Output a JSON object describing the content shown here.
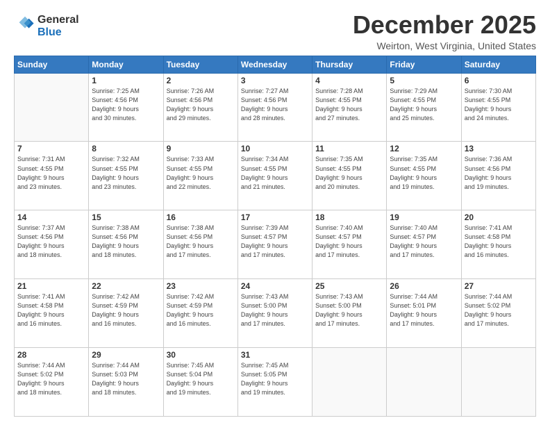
{
  "header": {
    "logo_line1": "General",
    "logo_line2": "Blue",
    "month": "December 2025",
    "location": "Weirton, West Virginia, United States"
  },
  "weekdays": [
    "Sunday",
    "Monday",
    "Tuesday",
    "Wednesday",
    "Thursday",
    "Friday",
    "Saturday"
  ],
  "weeks": [
    [
      {
        "day": "",
        "info": ""
      },
      {
        "day": "1",
        "info": "Sunrise: 7:25 AM\nSunset: 4:56 PM\nDaylight: 9 hours\nand 30 minutes."
      },
      {
        "day": "2",
        "info": "Sunrise: 7:26 AM\nSunset: 4:56 PM\nDaylight: 9 hours\nand 29 minutes."
      },
      {
        "day": "3",
        "info": "Sunrise: 7:27 AM\nSunset: 4:56 PM\nDaylight: 9 hours\nand 28 minutes."
      },
      {
        "day": "4",
        "info": "Sunrise: 7:28 AM\nSunset: 4:55 PM\nDaylight: 9 hours\nand 27 minutes."
      },
      {
        "day": "5",
        "info": "Sunrise: 7:29 AM\nSunset: 4:55 PM\nDaylight: 9 hours\nand 25 minutes."
      },
      {
        "day": "6",
        "info": "Sunrise: 7:30 AM\nSunset: 4:55 PM\nDaylight: 9 hours\nand 24 minutes."
      }
    ],
    [
      {
        "day": "7",
        "info": "Sunrise: 7:31 AM\nSunset: 4:55 PM\nDaylight: 9 hours\nand 23 minutes."
      },
      {
        "day": "8",
        "info": "Sunrise: 7:32 AM\nSunset: 4:55 PM\nDaylight: 9 hours\nand 23 minutes."
      },
      {
        "day": "9",
        "info": "Sunrise: 7:33 AM\nSunset: 4:55 PM\nDaylight: 9 hours\nand 22 minutes."
      },
      {
        "day": "10",
        "info": "Sunrise: 7:34 AM\nSunset: 4:55 PM\nDaylight: 9 hours\nand 21 minutes."
      },
      {
        "day": "11",
        "info": "Sunrise: 7:35 AM\nSunset: 4:55 PM\nDaylight: 9 hours\nand 20 minutes."
      },
      {
        "day": "12",
        "info": "Sunrise: 7:35 AM\nSunset: 4:55 PM\nDaylight: 9 hours\nand 19 minutes."
      },
      {
        "day": "13",
        "info": "Sunrise: 7:36 AM\nSunset: 4:56 PM\nDaylight: 9 hours\nand 19 minutes."
      }
    ],
    [
      {
        "day": "14",
        "info": "Sunrise: 7:37 AM\nSunset: 4:56 PM\nDaylight: 9 hours\nand 18 minutes."
      },
      {
        "day": "15",
        "info": "Sunrise: 7:38 AM\nSunset: 4:56 PM\nDaylight: 9 hours\nand 18 minutes."
      },
      {
        "day": "16",
        "info": "Sunrise: 7:38 AM\nSunset: 4:56 PM\nDaylight: 9 hours\nand 17 minutes."
      },
      {
        "day": "17",
        "info": "Sunrise: 7:39 AM\nSunset: 4:57 PM\nDaylight: 9 hours\nand 17 minutes."
      },
      {
        "day": "18",
        "info": "Sunrise: 7:40 AM\nSunset: 4:57 PM\nDaylight: 9 hours\nand 17 minutes."
      },
      {
        "day": "19",
        "info": "Sunrise: 7:40 AM\nSunset: 4:57 PM\nDaylight: 9 hours\nand 17 minutes."
      },
      {
        "day": "20",
        "info": "Sunrise: 7:41 AM\nSunset: 4:58 PM\nDaylight: 9 hours\nand 16 minutes."
      }
    ],
    [
      {
        "day": "21",
        "info": "Sunrise: 7:41 AM\nSunset: 4:58 PM\nDaylight: 9 hours\nand 16 minutes."
      },
      {
        "day": "22",
        "info": "Sunrise: 7:42 AM\nSunset: 4:59 PM\nDaylight: 9 hours\nand 16 minutes."
      },
      {
        "day": "23",
        "info": "Sunrise: 7:42 AM\nSunset: 4:59 PM\nDaylight: 9 hours\nand 16 minutes."
      },
      {
        "day": "24",
        "info": "Sunrise: 7:43 AM\nSunset: 5:00 PM\nDaylight: 9 hours\nand 17 minutes."
      },
      {
        "day": "25",
        "info": "Sunrise: 7:43 AM\nSunset: 5:00 PM\nDaylight: 9 hours\nand 17 minutes."
      },
      {
        "day": "26",
        "info": "Sunrise: 7:44 AM\nSunset: 5:01 PM\nDaylight: 9 hours\nand 17 minutes."
      },
      {
        "day": "27",
        "info": "Sunrise: 7:44 AM\nSunset: 5:02 PM\nDaylight: 9 hours\nand 17 minutes."
      }
    ],
    [
      {
        "day": "28",
        "info": "Sunrise: 7:44 AM\nSunset: 5:02 PM\nDaylight: 9 hours\nand 18 minutes."
      },
      {
        "day": "29",
        "info": "Sunrise: 7:44 AM\nSunset: 5:03 PM\nDaylight: 9 hours\nand 18 minutes."
      },
      {
        "day": "30",
        "info": "Sunrise: 7:45 AM\nSunset: 5:04 PM\nDaylight: 9 hours\nand 19 minutes."
      },
      {
        "day": "31",
        "info": "Sunrise: 7:45 AM\nSunset: 5:05 PM\nDaylight: 9 hours\nand 19 minutes."
      },
      {
        "day": "",
        "info": ""
      },
      {
        "day": "",
        "info": ""
      },
      {
        "day": "",
        "info": ""
      }
    ]
  ]
}
